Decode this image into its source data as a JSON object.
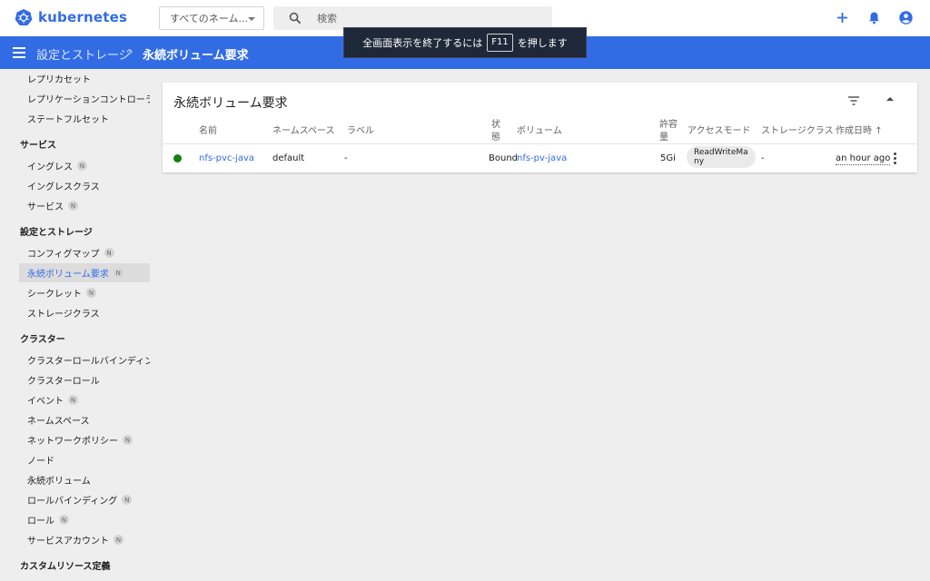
{
  "header": {
    "logo_text": "kubernetes",
    "namespace_select": "すべてのネーム...",
    "search_placeholder": "検索",
    "actions": [
      "plus-icon",
      "bell-icon",
      "account-icon"
    ],
    "brand_color": "#326ce5"
  },
  "toast": {
    "prefix": "全画面表示を終了するには",
    "key": "F11",
    "suffix": "を押します"
  },
  "breadcrumb": {
    "parent": "設定とストレージ",
    "separator": "›",
    "current": "永続ボリューム要求"
  },
  "sidebar": {
    "items": [
      {
        "label": "レプリカセット",
        "badge": ""
      },
      {
        "label": "レプリケーションコントローラー",
        "badge": ""
      },
      {
        "label": "ステートフルセット",
        "badge": ""
      },
      {
        "section": "サービス"
      },
      {
        "label": "イングレス",
        "badge": "N"
      },
      {
        "label": "イングレスクラス",
        "badge": ""
      },
      {
        "label": "サービス",
        "badge": "N"
      },
      {
        "section": "設定とストレージ"
      },
      {
        "label": "コンフィグマップ",
        "badge": "N"
      },
      {
        "label": "永続ボリューム要求",
        "badge": "N",
        "active": true
      },
      {
        "label": "シークレット",
        "badge": "N"
      },
      {
        "label": "ストレージクラス",
        "badge": ""
      },
      {
        "section": "クラスター"
      },
      {
        "label": "クラスターロールバインディング",
        "badge": ""
      },
      {
        "label": "クラスターロール",
        "badge": ""
      },
      {
        "label": "イベント",
        "badge": "N"
      },
      {
        "label": "ネームスペース",
        "badge": ""
      },
      {
        "label": "ネットワークポリシー",
        "badge": "N"
      },
      {
        "label": "ノード",
        "badge": ""
      },
      {
        "label": "永続ボリューム",
        "badge": ""
      },
      {
        "label": "ロールバインディング",
        "badge": "N"
      },
      {
        "label": "ロール",
        "badge": "N"
      },
      {
        "label": "サービスアカウント",
        "badge": "N"
      },
      {
        "section": "カスタムリソース定義"
      }
    ]
  },
  "card": {
    "title": "永続ボリューム要求",
    "columns": {
      "name": "名前",
      "namespace": "ネームスペース",
      "labels": "ラベル",
      "status_1": "状",
      "status_2": "態",
      "volume": "ボリューム",
      "capacity_1": "許容",
      "capacity_2": "量",
      "access_modes": "アクセスモード",
      "storage_class": "ストレージクラス",
      "created": "作成日時",
      "sort_indicator": "↑"
    },
    "rows": [
      {
        "status_color": "#13800f",
        "name": "nfs-pvc-java",
        "namespace": "default",
        "labels": "-",
        "status": "Bound",
        "volume": "nfs-pv-java",
        "capacity": "5Gi",
        "access_mode": "ReadWriteMany",
        "storage_class": "-",
        "created": "an hour ago"
      }
    ]
  }
}
